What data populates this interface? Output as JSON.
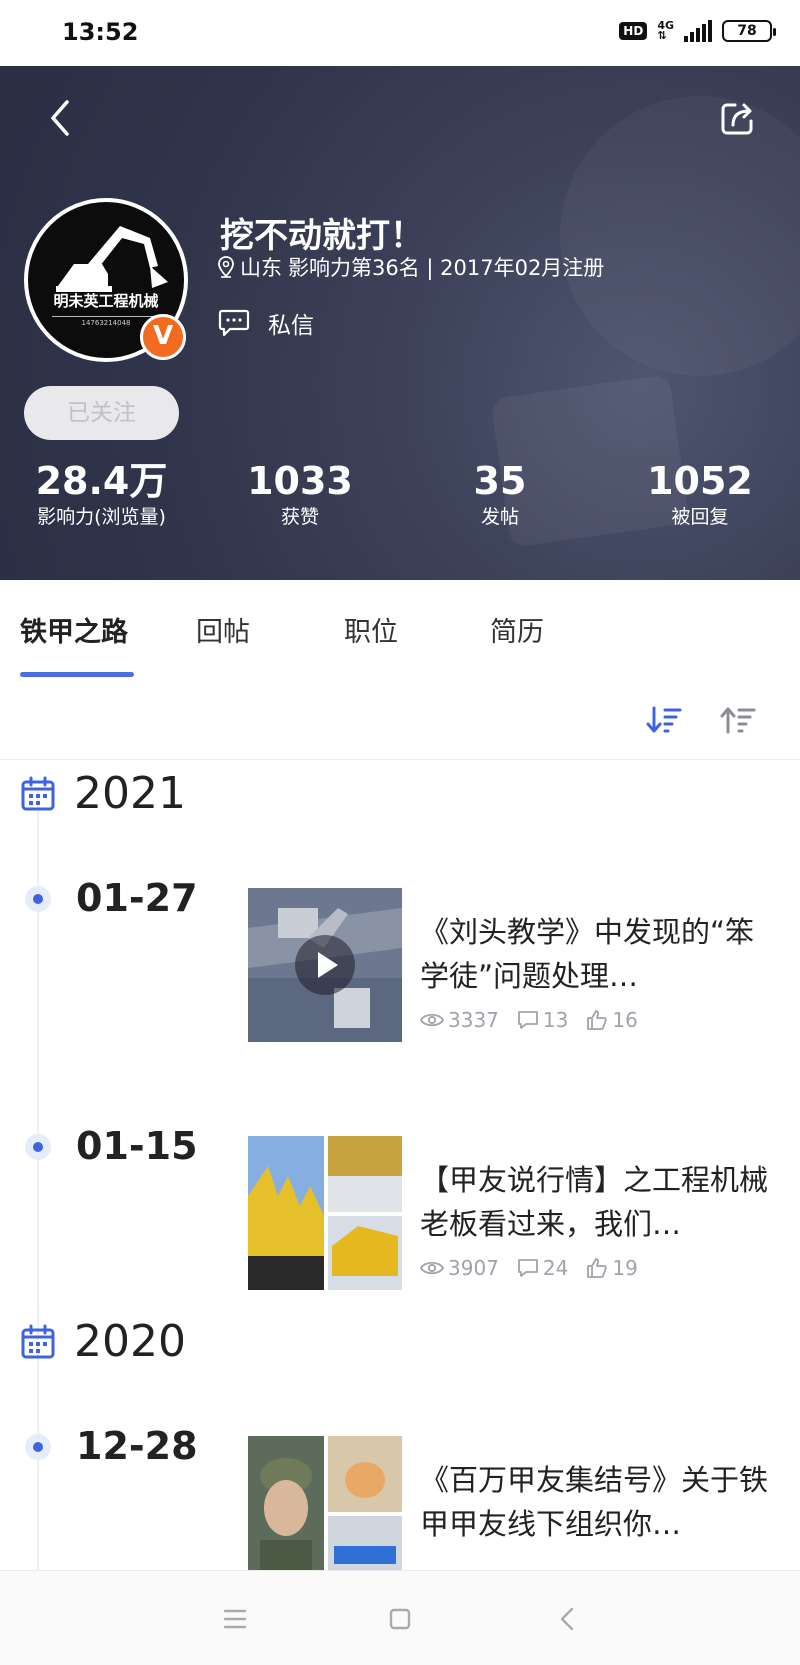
{
  "status_bar": {
    "time": "13:52",
    "hd": "HD",
    "network": "4G",
    "battery": "78"
  },
  "profile": {
    "name": "挖不动就打！",
    "location": "山东",
    "meta_text": "影响力第36名 | 2017年02月注册",
    "dm_label": "私信",
    "follow_label": "已关注",
    "avatar_text": "明未英工程机械",
    "avatar_subtext": "14763214048",
    "badge": "V"
  },
  "stats": [
    {
      "value": "28.4万",
      "label": "影响力(浏览量)"
    },
    {
      "value": "1033",
      "label": "获赞"
    },
    {
      "value": "35",
      "label": "发帖"
    },
    {
      "value": "1052",
      "label": "被回复"
    }
  ],
  "tabs": [
    {
      "label": "铁甲之路",
      "active": true
    },
    {
      "label": "回帖",
      "active": false
    },
    {
      "label": "职位",
      "active": false
    },
    {
      "label": "简历",
      "active": false
    }
  ],
  "timeline": {
    "years": [
      "2021",
      "2020"
    ],
    "entries": [
      {
        "date": "01-27",
        "title": "《刘头教学》中发现的“笨学徒”问题处理…",
        "views": "3337",
        "comments": "13",
        "likes": "16"
      },
      {
        "date": "01-15",
        "title": "【甲友说行情】之工程机械老板看过来，我们…",
        "views": "3907",
        "comments": "24",
        "likes": "19"
      },
      {
        "date": "12-28",
        "title": "《百万甲友集结号》关于铁甲甲友线下组织你…",
        "views": "",
        "comments": "",
        "likes": ""
      }
    ]
  },
  "colors": {
    "accent": "#4a6ee0",
    "header_bg": "#30344a",
    "badge": "#f26b21"
  }
}
